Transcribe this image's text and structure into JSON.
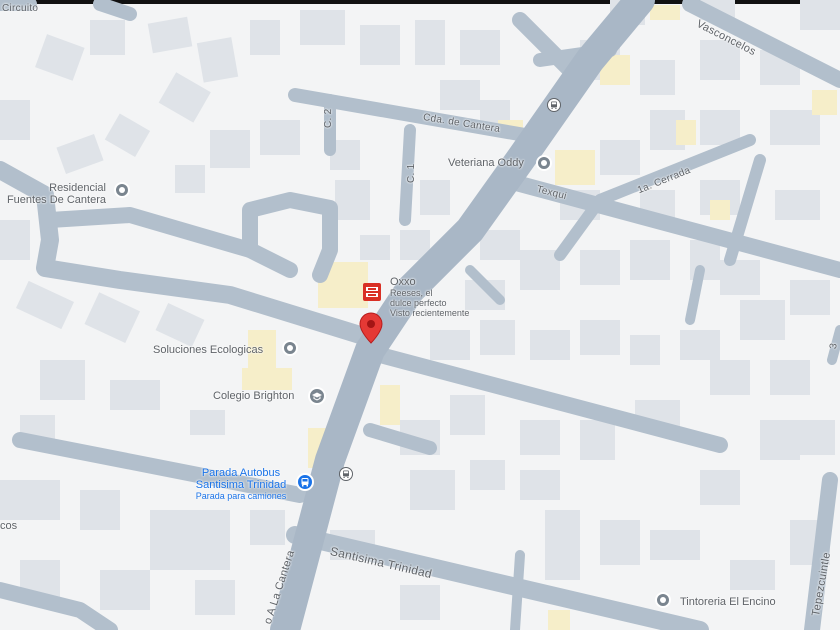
{
  "colors": {
    "land": "#f3f4f5",
    "building": "#dfe3e8",
    "road": "#a9b7c6",
    "road_minor": "#b2bfcc",
    "yellow_block": "#f6eec9",
    "selected_pin": "#e53935",
    "transit_blue": "#1a73e8",
    "oxxo_red": "#d93025"
  },
  "streets": {
    "circuito": "Circuito",
    "vasconcelos": "Vasconcelos",
    "c2": "C. 2",
    "c1": "C. 1",
    "cda_cantera": "Cda. de Cantera",
    "texqui": "Texqui",
    "cerrada": "1a. Cerrada",
    "santisima": "Santisima Trinidad",
    "camino": "o A La Cantera",
    "tepezcuintle": "Tepezcuintle",
    "num_right": "3"
  },
  "pois": {
    "residencial_line1": "Residencial",
    "residencial_line2": "Fuentes De Cantera",
    "veteriana": "Veteriana Oddy",
    "oxxo_title": "Oxxo",
    "oxxo_sub1": "Reeses, el",
    "oxxo_sub2": "dulce perfecto",
    "oxxo_sub3": "Visto recientemente",
    "soluciones": "Soluciones Ecologicas",
    "colegio": "Colegio Brighton",
    "parada_line1": "Parada Autobus",
    "parada_line2": "Santisima Trinidad",
    "parada_line3": "Parada para camiones",
    "tintoreria": "Tintoreria El Encino",
    "cos": "cos"
  },
  "icons": {
    "residencial": "place-marker-icon",
    "veteriana": "place-marker-icon",
    "soluciones": "place-marker-icon",
    "colegio": "school-icon",
    "parada": "bus-stop-icon",
    "tintoreria": "place-marker-icon",
    "oxxo": "store-icon",
    "selected": "selected-location-pin-icon",
    "bus_top": "bus-icon",
    "bus_mid": "bus-icon"
  }
}
